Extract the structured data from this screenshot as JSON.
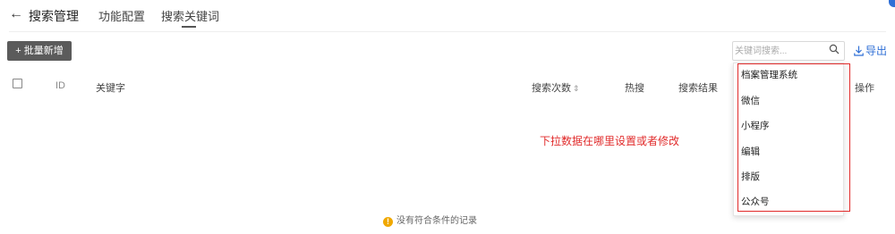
{
  "header": {
    "back_arrow": "←",
    "title": "搜索管理",
    "tabs": [
      {
        "label": "功能配置",
        "active": false
      },
      {
        "label": "搜索关键词",
        "active": true
      }
    ]
  },
  "toolbar": {
    "batch_add_label": "+ 批量新增",
    "search_placeholder": "关键词搜索...",
    "search_icon": "search-icon",
    "export_label": "导出",
    "export_icon": "download-icon"
  },
  "table": {
    "columns": [
      "ID",
      "关键字",
      "搜索次数",
      "热搜",
      "搜索结果",
      "操作"
    ],
    "sortable_column": "搜索次数",
    "empty_text": "没有符合条件的记录"
  },
  "dropdown": {
    "options": [
      "档案管理系统",
      "微信",
      "小程序",
      "编辑",
      "排版",
      "公众号"
    ]
  },
  "annotation": {
    "text": "下拉数据在哪里设置或者修改",
    "color": "#e12b2b"
  },
  "colors": {
    "accent": "#2f6fd6",
    "button_bg": "#5b5b5b",
    "warning": "#f0a800"
  }
}
